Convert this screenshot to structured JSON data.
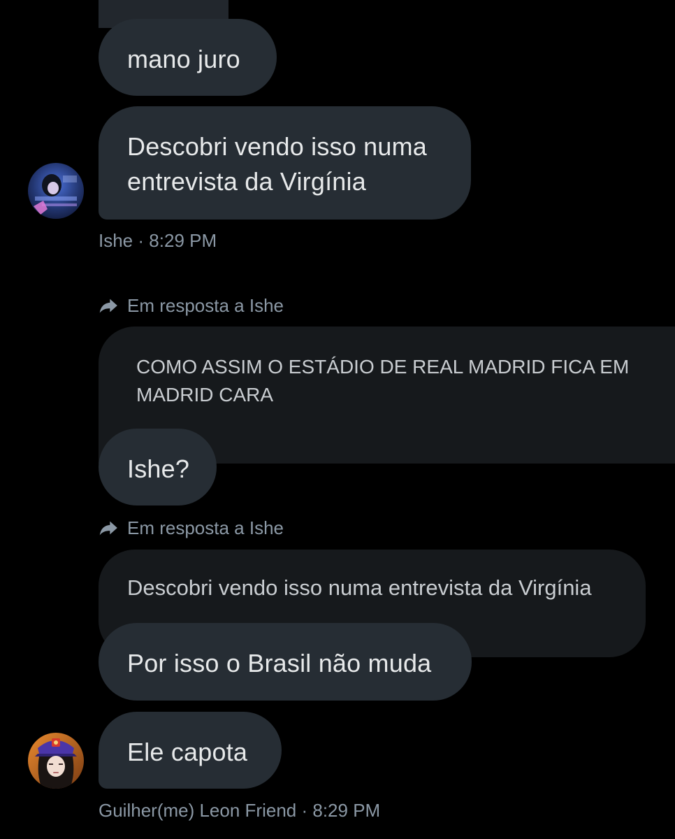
{
  "messages": {
    "mano_juro": "mano juro",
    "descobri_line1": "Descobri vendo isso numa",
    "descobri_line2": "entrevista da Virgínia",
    "ishe_name": "Ishe",
    "ishe_time": "8:29 PM",
    "ishe_question": "Ishe?",
    "por_isso": "Por isso o Brasil não muda",
    "ele_capota": "Ele capota",
    "guilherme_name": "Guilher(me) Leon Friend",
    "guilherme_time": "8:29 PM"
  },
  "replies": [
    {
      "context": "Em resposta a Ishe",
      "quote_line1": "COMO ASSIM O ESTÁDIO DE REAL MADRID FICA EM",
      "quote_line2": "MADRID CARA"
    },
    {
      "context": "Em resposta a Ishe",
      "quote_line1": "Descobri vendo isso numa entrevista da Virgínia"
    }
  ],
  "meta_separator": "·",
  "colors": {
    "background": "#000000",
    "bubble": "#262d34",
    "quote": "#16191c",
    "meta_text": "#8b98a5"
  },
  "icons": [
    "reply-arrow-icon"
  ]
}
